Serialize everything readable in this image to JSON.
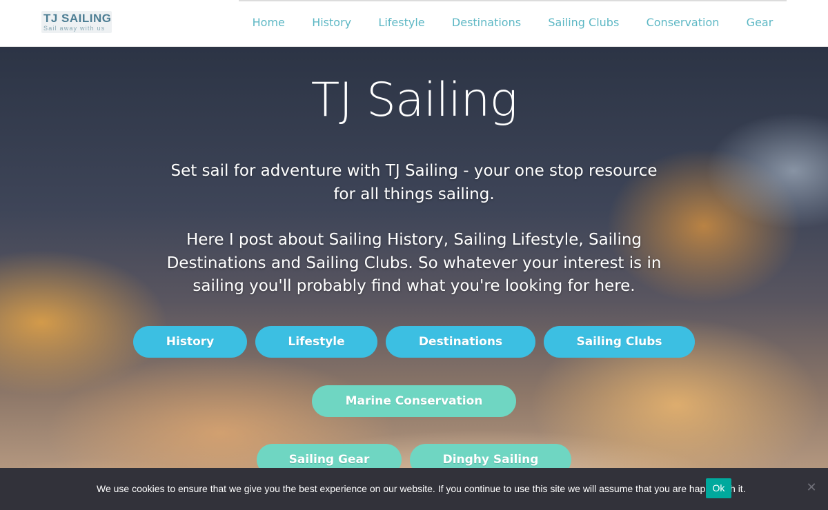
{
  "header": {
    "logo_title": "TJ SAILING",
    "logo_tagline": "Sail away with us",
    "nav": [
      "Home",
      "History",
      "Lifestyle",
      "Destinations",
      "Sailing Clubs",
      "Conservation",
      "Gear"
    ]
  },
  "hero": {
    "title": "TJ Sailing",
    "intro": "Set sail for adventure with TJ Sailing - your one stop resource for all things sailing.",
    "description": "Here I post about Sailing History, Sailing Lifestyle, Sailing Destinations and Sailing Clubs. So whatever your interest is in sailing you'll probably find what you're looking for here.",
    "buttons": [
      "History",
      "Lifestyle",
      "Destinations",
      "Sailing Clubs",
      "Marine Conservation",
      "Sailing Gear",
      "Dinghy Sailing"
    ]
  },
  "cookie": {
    "text": "We use cookies to ensure that we give you the best experience on our website. If you continue to use this site we will assume that you are happy with it.",
    "ok_label": "Ok",
    "close_symbol": "✕"
  },
  "colors": {
    "nav_link": "#5cb7c4",
    "button_blue": "#3cbfe2",
    "button_teal": "#6fd6c2",
    "cookie_bg": "#32323a",
    "cookie_ok": "#00a99d"
  }
}
